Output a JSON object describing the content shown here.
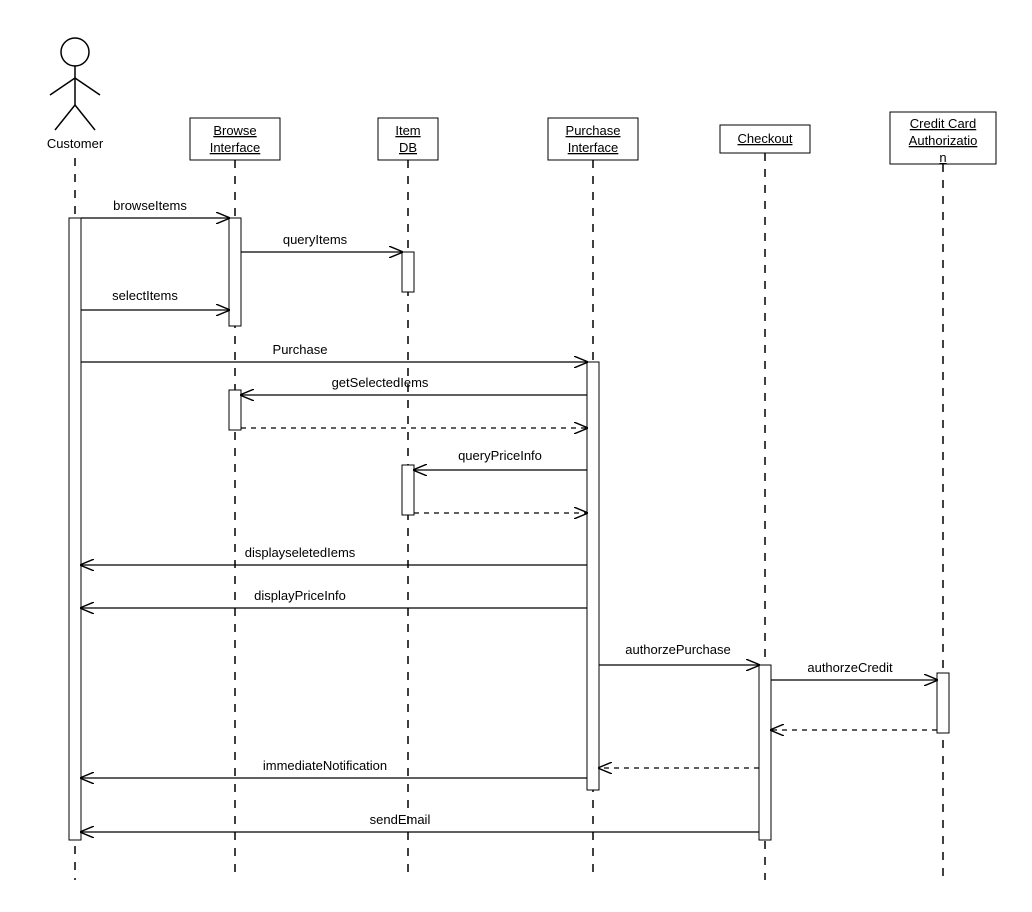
{
  "participants": {
    "customer": "Customer",
    "browse": "Browse Interface",
    "itemdb": "Item DB",
    "purchase": "Purchase Interface",
    "checkout": "Checkout",
    "creditcard": "Credit Card Authorization"
  },
  "messages": {
    "browseItems": "browseItems",
    "queryItems": "queryItems",
    "selectItems": "selectItems",
    "purchase": "Purchase",
    "getSelectedItems": "getSelectedIems",
    "queryPriceInfo": "queryPriceInfo",
    "displaySelectedItems": "displayseletedIems",
    "displayPriceInfo": "displayPriceInfo",
    "authorizePurchase": "authorzePurchase",
    "authorizeCredit": "authorzeCredit",
    "immediateNotification": "immediateNotification",
    "sendEmail": "sendEmail"
  }
}
